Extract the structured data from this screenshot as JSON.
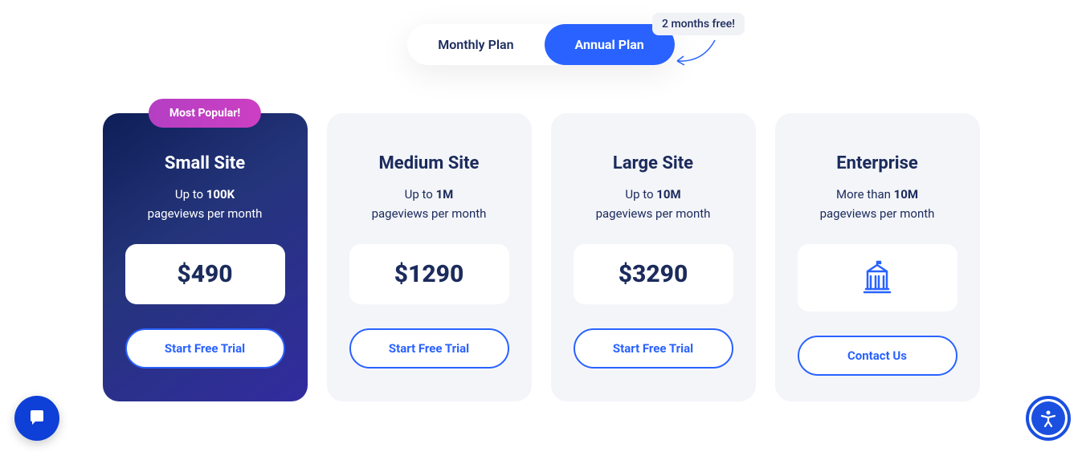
{
  "promo": {
    "label": "2 months free!"
  },
  "toggle": {
    "monthly": "Monthly Plan",
    "annual": "Annual Plan"
  },
  "plans": [
    {
      "name": "Small Site",
      "desc_prefix": "Up to ",
      "desc_bold": "100K",
      "desc_suffix": "pageviews per month",
      "price": "$490",
      "cta": "Start Free Trial",
      "badge": "Most Popular!"
    },
    {
      "name": "Medium Site",
      "desc_prefix": "Up to ",
      "desc_bold": "1M",
      "desc_suffix": "pageviews per month",
      "price": "$1290",
      "cta": "Start Free Trial"
    },
    {
      "name": "Large Site",
      "desc_prefix": "Up to ",
      "desc_bold": "10M",
      "desc_suffix": "pageviews per month",
      "price": "$3290",
      "cta": "Start Free Trial"
    },
    {
      "name": "Enterprise",
      "desc_prefix": "More than ",
      "desc_bold": "10M",
      "desc_suffix": "pageviews per month",
      "cta": "Contact Us"
    }
  ]
}
